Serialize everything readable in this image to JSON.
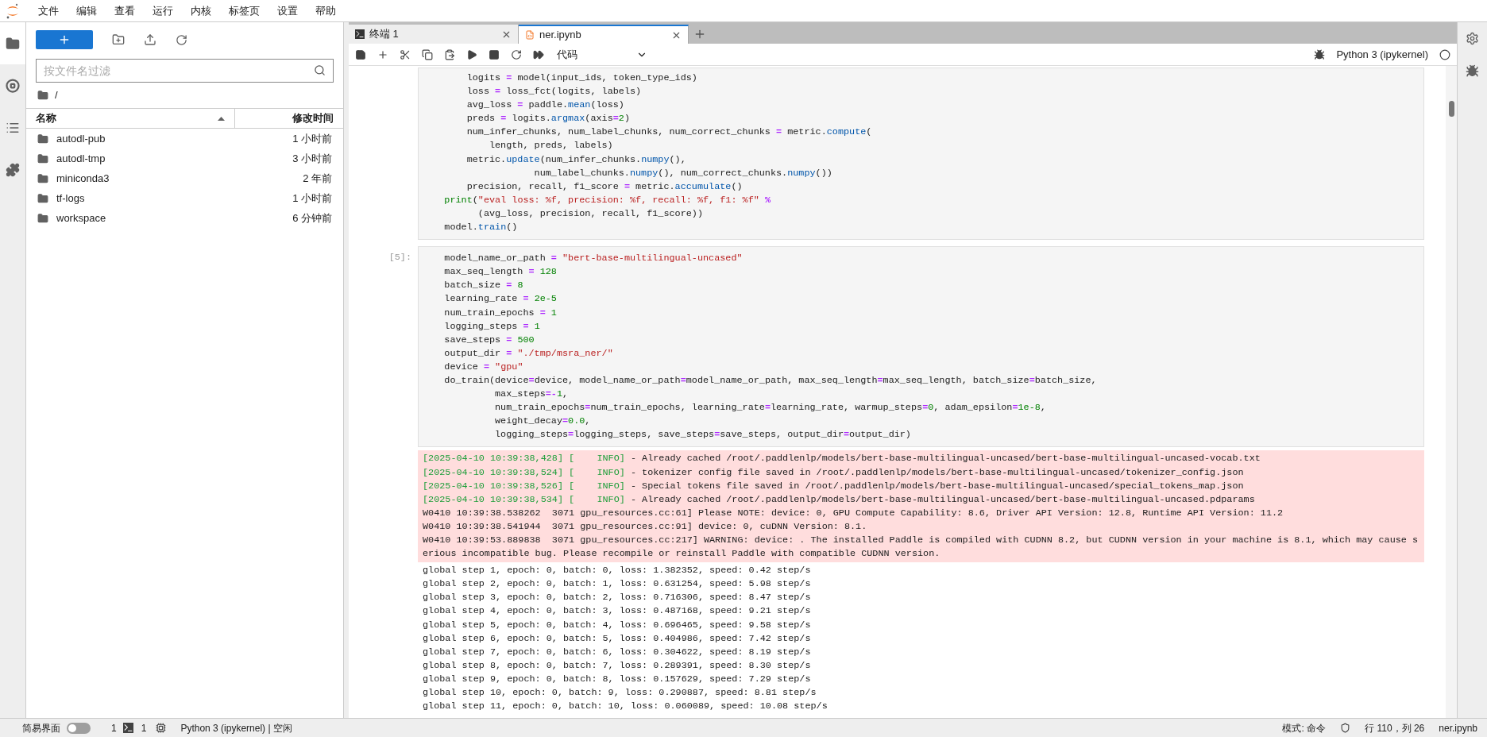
{
  "menu": [
    "文件",
    "编辑",
    "查看",
    "运行",
    "内核",
    "标签页",
    "设置",
    "帮助"
  ],
  "left_bar": [
    {
      "kind": "folder",
      "selected": true
    },
    {
      "kind": "running",
      "selected": false
    },
    {
      "kind": "toc",
      "selected": false
    },
    {
      "kind": "extensions",
      "selected": false
    }
  ],
  "file_browser": {
    "filter_placeholder": "按文件名过滤",
    "breadcrumb": "/",
    "columns": [
      "名称",
      "修改时间"
    ],
    "rows": [
      {
        "name": "autodl-pub",
        "modified": "1 小时前"
      },
      {
        "name": "autodl-tmp",
        "modified": "3 小时前"
      },
      {
        "name": "miniconda3",
        "modified": "2 年前"
      },
      {
        "name": "tf-logs",
        "modified": "1 小时前"
      },
      {
        "name": "workspace",
        "modified": "6 分钟前"
      }
    ]
  },
  "tabs": [
    {
      "label": "终端 1",
      "kind": "terminal",
      "selected": false
    },
    {
      "label": "ner.ipynb",
      "kind": "notebook",
      "selected": true
    }
  ],
  "toolbar": {
    "cell_type": "代码",
    "kernel": "Python 3 (ipykernel)"
  },
  "cells": [
    {
      "lines": [
        [
          {
            "text": "        logits "
          },
          {
            "text": "=",
            "kind": "op"
          },
          {
            "text": " model(input_ids, token_type_ids)"
          }
        ],
        [
          {
            "text": "        loss "
          },
          {
            "text": "=",
            "kind": "op"
          },
          {
            "text": " loss_fct(logits, labels)"
          }
        ],
        [
          {
            "text": "        avg_loss "
          },
          {
            "text": "=",
            "kind": "op"
          },
          {
            "text": " paddle."
          },
          {
            "text": "mean",
            "kind": "fn"
          },
          {
            "text": "(loss)"
          }
        ],
        [
          {
            "text": "        preds "
          },
          {
            "text": "=",
            "kind": "op"
          },
          {
            "text": " logits."
          },
          {
            "text": "argmax",
            "kind": "fn"
          },
          {
            "text": "(axis"
          },
          {
            "text": "=",
            "kind": "op"
          },
          {
            "text": "2",
            "kind": "num"
          },
          {
            "text": ")"
          }
        ],
        [
          {
            "text": "        num_infer_chunks, num_label_chunks, num_correct_chunks "
          },
          {
            "text": "=",
            "kind": "op"
          },
          {
            "text": " metric."
          },
          {
            "text": "compute",
            "kind": "fn"
          },
          {
            "text": "("
          }
        ],
        [
          {
            "text": "            length, preds, labels)"
          }
        ],
        [
          {
            "text": "        metric."
          },
          {
            "text": "update",
            "kind": "fn"
          },
          {
            "text": "(num_infer_chunks."
          },
          {
            "text": "numpy",
            "kind": "fn"
          },
          {
            "text": "(),"
          }
        ],
        [
          {
            "text": "                    num_label_chunks."
          },
          {
            "text": "numpy",
            "kind": "fn"
          },
          {
            "text": "(), num_correct_chunks."
          },
          {
            "text": "numpy",
            "kind": "fn"
          },
          {
            "text": "())"
          }
        ],
        [
          {
            "text": "        precision, recall, f1_score "
          },
          {
            "text": "=",
            "kind": "op"
          },
          {
            "text": " metric."
          },
          {
            "text": "accumulate",
            "kind": "fn"
          },
          {
            "text": "()"
          }
        ],
        [
          {
            "text": "    print",
            "kind": "builtin"
          },
          {
            "text": "("
          },
          {
            "text": "\"eval loss: %f, precision: %f, recall: %f, f1: %f\"",
            "kind": "str"
          },
          {
            "text": " %",
            "kind": "op"
          }
        ],
        [
          {
            "text": "          (avg_loss, precision, recall, f1_score))"
          }
        ],
        [
          {
            "text": "    model."
          },
          {
            "text": "train",
            "kind": "fn"
          },
          {
            "text": "()"
          }
        ]
      ]
    },
    {
      "prompt": "[5]:",
      "lines": [
        [
          {
            "text": "    model_name_or_path "
          },
          {
            "text": "=",
            "kind": "op"
          },
          {
            "text": " \"bert-base-multilingual-uncased\"",
            "kind": "str"
          }
        ],
        [
          {
            "text": "    max_seq_length "
          },
          {
            "text": "=",
            "kind": "op"
          },
          {
            "text": " 128",
            "kind": "num"
          }
        ],
        [
          {
            "text": "    batch_size "
          },
          {
            "text": "=",
            "kind": "op"
          },
          {
            "text": " 8",
            "kind": "num"
          }
        ],
        [
          {
            "text": "    learning_rate "
          },
          {
            "text": "=",
            "kind": "op"
          },
          {
            "text": " 2e-5",
            "kind": "num"
          }
        ],
        [
          {
            "text": "    num_train_epochs "
          },
          {
            "text": "=",
            "kind": "op"
          },
          {
            "text": " 1",
            "kind": "num"
          }
        ],
        [
          {
            "text": "    logging_steps "
          },
          {
            "text": "=",
            "kind": "op"
          },
          {
            "text": " 1",
            "kind": "num"
          }
        ],
        [
          {
            "text": "    save_steps "
          },
          {
            "text": "=",
            "kind": "op"
          },
          {
            "text": " 500",
            "kind": "num"
          }
        ],
        [
          {
            "text": "    output_dir "
          },
          {
            "text": "=",
            "kind": "op"
          },
          {
            "text": " \"./tmp/msra_ner/\"",
            "kind": "str"
          }
        ],
        [
          {
            "text": "    device "
          },
          {
            "text": "=",
            "kind": "op"
          },
          {
            "text": " \"gpu\"",
            "kind": "str"
          }
        ],
        [
          {
            "text": "    do_train(device"
          },
          {
            "text": "=",
            "kind": "op"
          },
          {
            "text": "device, model_name_or_path"
          },
          {
            "text": "=",
            "kind": "op"
          },
          {
            "text": "model_name_or_path, max_seq_length"
          },
          {
            "text": "=",
            "kind": "op"
          },
          {
            "text": "max_seq_length, batch_size"
          },
          {
            "text": "=",
            "kind": "op"
          },
          {
            "text": "batch_size,"
          }
        ],
        [
          {
            "text": "             max_steps"
          },
          {
            "text": "=-",
            "kind": "op"
          },
          {
            "text": "1",
            "kind": "num"
          },
          {
            "text": ","
          }
        ],
        [
          {
            "text": "             num_train_epochs"
          },
          {
            "text": "=",
            "kind": "op"
          },
          {
            "text": "num_train_epochs, learning_rate"
          },
          {
            "text": "=",
            "kind": "op"
          },
          {
            "text": "learning_rate, warmup_steps"
          },
          {
            "text": "=",
            "kind": "op"
          },
          {
            "text": "0",
            "kind": "num"
          },
          {
            "text": ", adam_epsilon"
          },
          {
            "text": "=",
            "kind": "op"
          },
          {
            "text": "1e-8",
            "kind": "num"
          },
          {
            "text": ","
          }
        ],
        [
          {
            "text": "             weight_decay"
          },
          {
            "text": "=",
            "kind": "op"
          },
          {
            "text": "0.0",
            "kind": "num"
          },
          {
            "text": ","
          }
        ],
        [
          {
            "text": "             logging_steps"
          },
          {
            "text": "=",
            "kind": "op"
          },
          {
            "text": "logging_steps, save_steps"
          },
          {
            "text": "=",
            "kind": "op"
          },
          {
            "text": "save_steps, output_dir"
          },
          {
            "text": "=",
            "kind": "op"
          },
          {
            "text": "output_dir)"
          }
        ]
      ]
    }
  ],
  "output": {
    "stderr": [
      [
        {
          "text": "[2025-04-10 10:39:38,428] [    INFO]",
          "kind": "log"
        },
        {
          "text": " - Already cached /root/.paddlenlp/models/bert-base-multilingual-uncased/bert-base-multilingual-uncased-vocab.txt"
        }
      ],
      [
        {
          "text": "[2025-04-10 10:39:38,524] [    INFO]",
          "kind": "log"
        },
        {
          "text": " - tokenizer config file saved in /root/.paddlenlp/models/bert-base-multilingual-uncased/tokenizer_config.json"
        }
      ],
      [
        {
          "text": "[2025-04-10 10:39:38,526] [    INFO]",
          "kind": "log"
        },
        {
          "text": " - Special tokens file saved in /root/.paddlenlp/models/bert-base-multilingual-uncased/special_tokens_map.json"
        }
      ],
      [
        {
          "text": "[2025-04-10 10:39:38,534] [    INFO]",
          "kind": "log"
        },
        {
          "text": " - Already cached /root/.paddlenlp/models/bert-base-multilingual-uncased/bert-base-multilingual-uncased.pdparams"
        }
      ],
      [
        {
          "text": "W0410 10:39:38.538262  3071 gpu_resources.cc:61] Please NOTE: device: 0, GPU Compute Capability: 8.6, Driver API Version: 12.8, Runtime API Version: 11.2"
        }
      ],
      [
        {
          "text": "W0410 10:39:38.541944  3071 gpu_resources.cc:91] device: 0, cuDNN Version: 8.1."
        }
      ],
      [
        {
          "text": "W0410 10:39:53.889838  3071 gpu_resources.cc:217] WARNING: device: . The installed Paddle is compiled with CUDNN 8.2, but CUDNN version in your machine is 8.1, which may cause serious incompatible bug. Please recompile or reinstall Paddle with compatible CUDNN version."
        }
      ]
    ],
    "stdout": [
      "global step 1, epoch: 0, batch: 0, loss: 1.382352, speed: 0.42 step/s",
      "global step 2, epoch: 0, batch: 1, loss: 0.631254, speed: 5.98 step/s",
      "global step 3, epoch: 0, batch: 2, loss: 0.716306, speed: 8.47 step/s",
      "global step 4, epoch: 0, batch: 3, loss: 0.487168, speed: 9.21 step/s",
      "global step 5, epoch: 0, batch: 4, loss: 0.696465, speed: 9.58 step/s",
      "global step 6, epoch: 0, batch: 5, loss: 0.404986, speed: 7.42 step/s",
      "global step 7, epoch: 0, batch: 6, loss: 0.304622, speed: 8.19 step/s",
      "global step 8, epoch: 0, batch: 7, loss: 0.289391, speed: 8.30 step/s",
      "global step 9, epoch: 0, batch: 8, loss: 0.157629, speed: 7.29 step/s",
      "global step 10, epoch: 0, batch: 9, loss: 0.290887, speed: 8.81 step/s",
      "global step 11, epoch: 0, batch: 10, loss: 0.060089, speed: 10.08 step/s"
    ]
  },
  "status_bar": {
    "simple_mode_label": "简易界面",
    "simple_mode_on": false,
    "terminals": "1",
    "kernels": "1",
    "kernel_status": "Python 3 (ipykernel) | 空闲",
    "mode": "模式: 命令",
    "position": "行 110，列 26",
    "file": "ner.ipynb"
  }
}
